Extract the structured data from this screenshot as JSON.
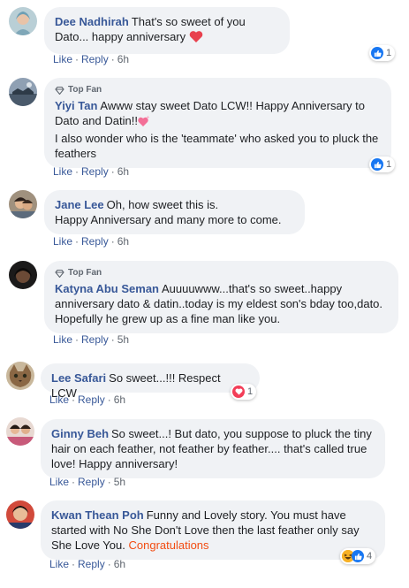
{
  "comments": [
    {
      "author": "Dee Nadhirah",
      "text": "That's so sweet of you Dato... happy anniversary",
      "actions": {
        "like": "Like",
        "reply": "Reply",
        "time": "6h"
      },
      "reactions": {
        "count": "1",
        "icons": [
          "like-icon"
        ]
      }
    },
    {
      "badge": "Top Fan",
      "author": "Yiyi Tan",
      "text": "Awww stay sweet Dato LCW!! Happy Anniversary to Dato and Datin!!",
      "text2": "I also wonder who is the 'teammate' who asked you to pluck the feathers",
      "actions": {
        "like": "Like",
        "reply": "Reply",
        "time": "6h"
      },
      "reactions": {
        "count": "1",
        "icons": [
          "like-icon"
        ]
      }
    },
    {
      "author": "Jane Lee",
      "text": "Oh, how sweet this is.",
      "text2": "Happy Anniversary and many more to come.",
      "actions": {
        "like": "Like",
        "reply": "Reply",
        "time": "6h"
      }
    },
    {
      "badge": "Top Fan",
      "author": "Katyna Abu Seman",
      "text": "Auuuuwww...that's so sweet..happy anniversary dato & datin..today is my eldest son's bday too,dato. Hopefully he grew up as a fine man like you.",
      "actions": {
        "like": "Like",
        "reply": "Reply",
        "time": "5h"
      }
    },
    {
      "author": "Lee Safari",
      "text": "So sweet...!!! Respect LCW",
      "actions": {
        "like": "Like",
        "reply": "Reply",
        "time": "6h"
      },
      "reactions": {
        "count": "1",
        "icons": [
          "love-icon"
        ]
      }
    },
    {
      "author": "Ginny Beh",
      "text": "So sweet...! But dato, you suppose to pluck the tiny hair on each feather, not feather by feather.... that's called true love! Happy anniversary!",
      "actions": {
        "like": "Like",
        "reply": "Reply",
        "time": "5h"
      }
    },
    {
      "author": "Kwan Thean Poh",
      "text": "Funny and Lovely story. You must have started with No She Don't Love then the last feather only say She Love You.",
      "highlight": "Congratulations",
      "actions": {
        "like": "Like",
        "reply": "Reply",
        "time": "6h"
      },
      "reactions": {
        "count": "4",
        "icons": [
          "haha-icon",
          "like-icon"
        ]
      }
    }
  ],
  "colors": {
    "link": "#385898",
    "bubble": "#f0f2f5",
    "like": "#1877f2",
    "love": "#f33e58",
    "congrats": "#f24c12"
  }
}
